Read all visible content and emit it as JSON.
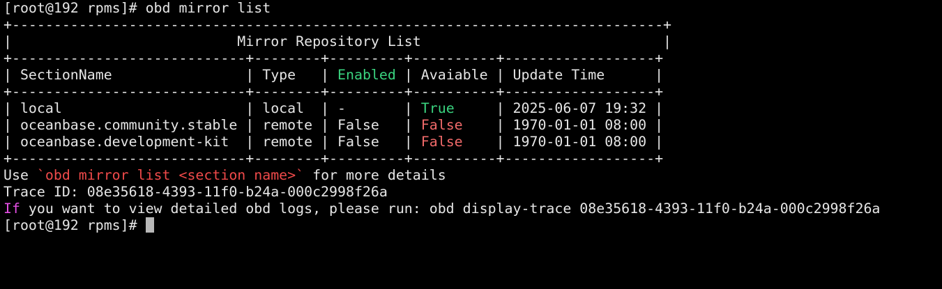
{
  "prompt1": "[root@192 rpms]# obd mirror list",
  "table": {
    "border_full": "+------------------------------------------------------------------------------+",
    "title": "|                           Mirror Repository List                             |",
    "border_cols": "+----------------------------+--------+---------+----------+------------------+",
    "header": {
      "c1": "| SectionName                | Type   | ",
      "enabled": "Enabled",
      "c3": " | Avaiable | Update Time      |"
    },
    "rows": [
      {
        "pre": "| local                      | local  | -       | ",
        "avail": "True",
        "pad": "     | ",
        "time": "2025-06-07 19:32 |"
      },
      {
        "pre": "| oceanbase.community.stable | remote | False   | ",
        "avail": "False",
        "pad": "    | ",
        "time": "1970-01-01 08:00 |"
      },
      {
        "pre": "| oceanbase.development-kit  | remote | False   | ",
        "avail": "False",
        "pad": "    | ",
        "time": "1970-01-01 08:00 |"
      }
    ]
  },
  "hint": {
    "prefix": "Use ",
    "command": "`obd mirror list <section name>`",
    "suffix": " for more details"
  },
  "trace_line": "Trace ID: 08e35618-4393-11f0-b24a-000c2998f26a",
  "log_hint": {
    "if_word": "If",
    "rest": " you want to view detailed obd logs, please run: obd display-trace 08e35618-4393-11f0-b24a-000c2998f26a"
  },
  "prompt2": "[root@192 rpms]#",
  "colors": {
    "background": "#000000",
    "text": "#e6e6e6",
    "green": "#3ad37f",
    "red": "#f04a4a",
    "magenta": "#e54fe5",
    "cursor": "#b8b8b8"
  }
}
